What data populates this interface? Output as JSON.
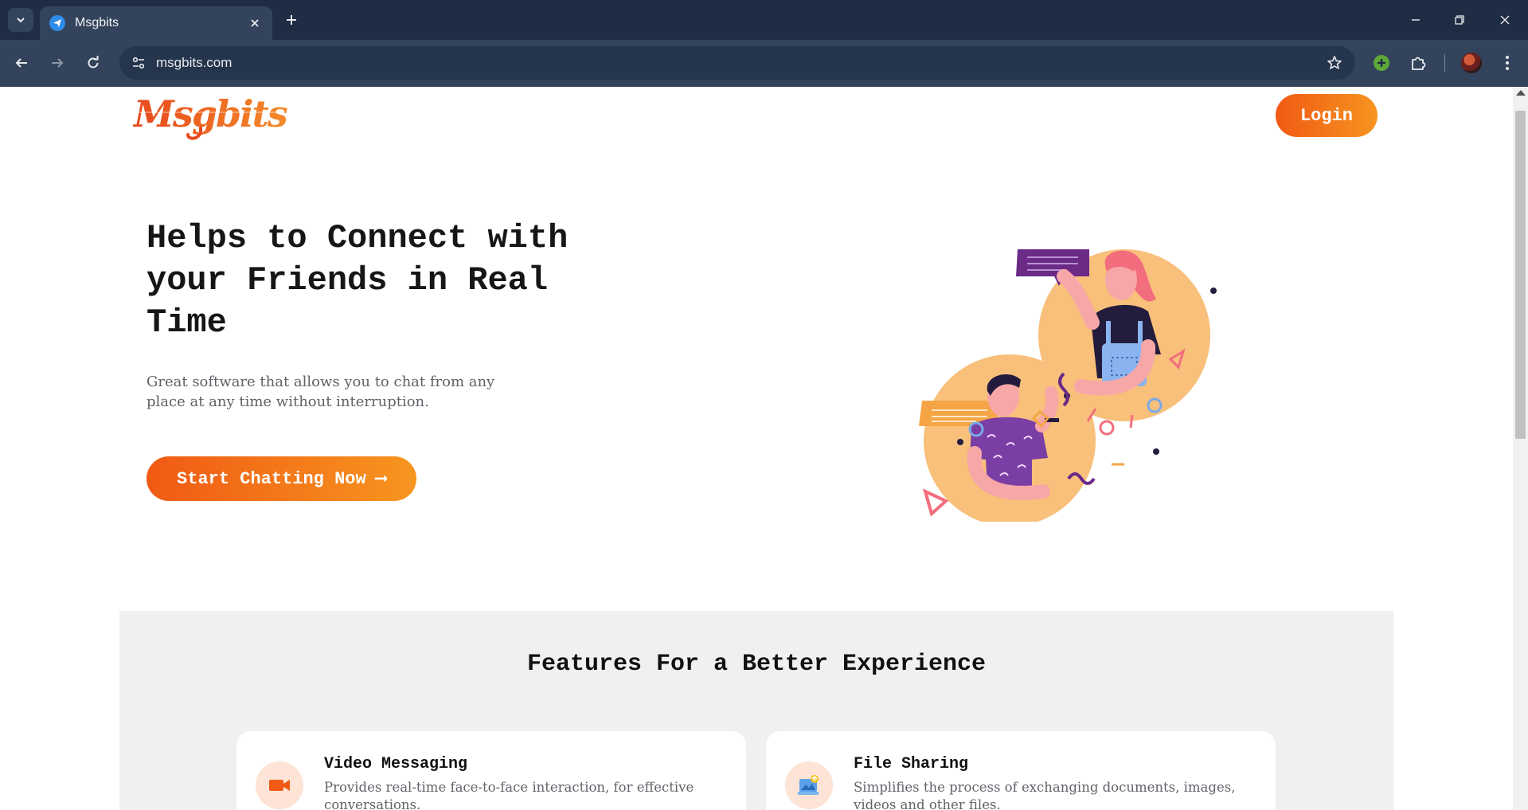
{
  "browser": {
    "tab_title": "Msgbits",
    "url": "msgbits.com"
  },
  "header": {
    "logo_text": "Msgbits",
    "login_label": "Login"
  },
  "hero": {
    "title": "Helps to Connect with your Friends in Real Time",
    "subtitle": "Great software that allows you to chat from any place at any time without interruption.",
    "cta_label": "Start Chatting Now",
    "cta_arrow": "⟶"
  },
  "features": {
    "title": "Features For a Better Experience",
    "items": [
      {
        "name": "Video Messaging",
        "description": "Provides real-time face-to-face interaction, for effective conversations.",
        "icon": "video-camera-icon"
      },
      {
        "name": "File Sharing",
        "description": "Simplifies the process of exchanging documents, images, videos and other files.",
        "icon": "image-upload-icon"
      }
    ]
  },
  "colors": {
    "brand_orange": "#f05a14",
    "brand_orange_light": "#f7951f",
    "chrome_dark": "#1f2d44",
    "chrome_toolbar": "#33435c",
    "features_bg": "#f0f0f0"
  }
}
